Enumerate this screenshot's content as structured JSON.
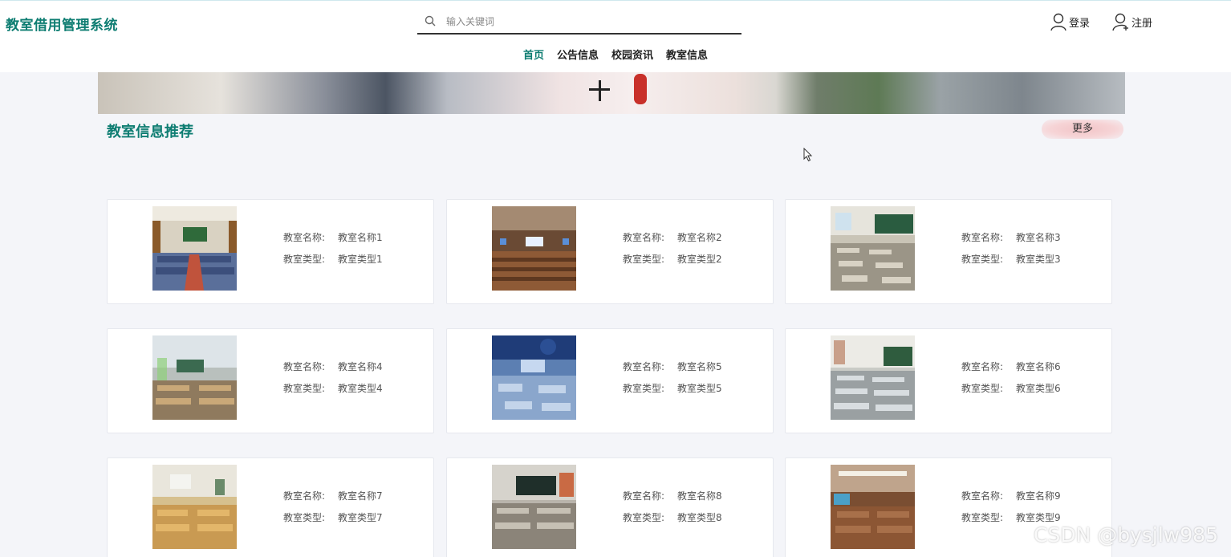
{
  "header": {
    "site_title": "教室借用管理系统",
    "search_placeholder": "输入关键词",
    "search_value": "",
    "login_label": "登录",
    "register_label": "注册"
  },
  "nav": {
    "items": [
      "首页",
      "公告信息",
      "校园资讯",
      "教室信息"
    ],
    "active_index": 0
  },
  "section": {
    "title": "教室信息推荐",
    "more_label": "更多"
  },
  "card_fields": {
    "name_label": "教室名称:",
    "type_label": "教室类型:"
  },
  "classrooms": [
    {
      "name": "教室名称1",
      "type": "教室类型1"
    },
    {
      "name": "教室名称2",
      "type": "教室类型2"
    },
    {
      "name": "教室名称3",
      "type": "教室类型3"
    },
    {
      "name": "教室名称4",
      "type": "教室类型4"
    },
    {
      "name": "教室名称5",
      "type": "教室类型5"
    },
    {
      "name": "教室名称6",
      "type": "教室类型6"
    },
    {
      "name": "教室名称7",
      "type": "教室类型7"
    },
    {
      "name": "教室名称8",
      "type": "教室类型8"
    },
    {
      "name": "教室名称9",
      "type": "教室类型9"
    }
  ],
  "watermark": "CSDN @bysjlw985",
  "colors": {
    "brand": "#0e7d72",
    "page_bg": "#f4f5f9",
    "more_button": "#f2c4c7"
  }
}
